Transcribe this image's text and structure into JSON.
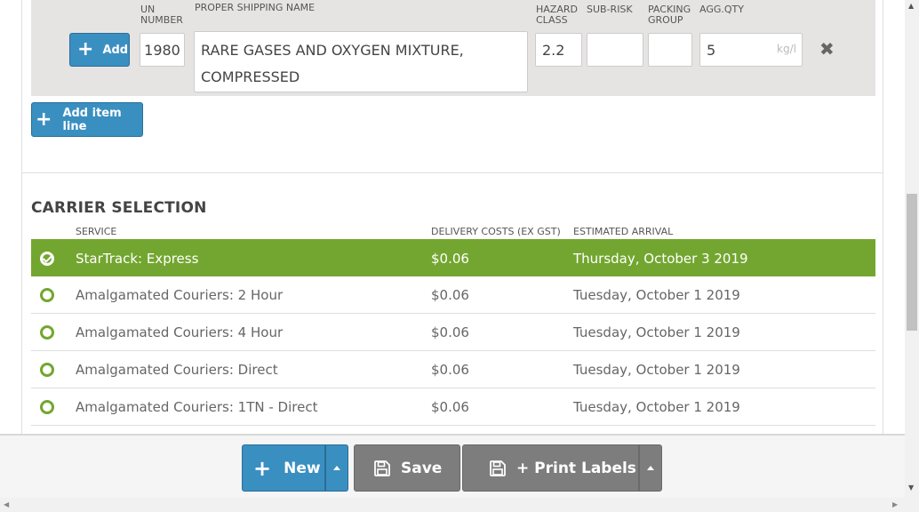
{
  "dg_item": {
    "add_label": "Add",
    "labels": {
      "un_number": "UN NUMBER",
      "proper_shipping_name": "PROPER SHIPPING NAME",
      "hazard_class": "HAZARD CLASS",
      "sub_risk": "SUB-RISK",
      "packing_group": "PACKING GROUP",
      "agg_qty": "AGG.QTY"
    },
    "un_number": "1980",
    "proper_shipping_name": "RARE GASES AND OXYGEN MIXTURE, COMPRESSED",
    "hazard_class": "2.2",
    "sub_risk": "",
    "packing_group": "",
    "agg_qty": "5",
    "agg_qty_unit": "kg/l",
    "remove_glyph": "✖"
  },
  "add_item_line_label": "Add item line",
  "carrier_selection": {
    "title": "CARRIER SELECTION",
    "columns": {
      "service": "SERVICE",
      "cost": "DELIVERY COSTS (EX GST)",
      "eta": "ESTIMATED ARRIVAL"
    },
    "rows": [
      {
        "service": "StarTrack: Express",
        "cost": "$0.06",
        "eta": "Thursday, October 3 2019",
        "selected": true
      },
      {
        "service": "Amalgamated Couriers: 2 Hour",
        "cost": "$0.06",
        "eta": "Tuesday, October 1 2019",
        "selected": false
      },
      {
        "service": "Amalgamated Couriers: 4 Hour",
        "cost": "$0.06",
        "eta": "Tuesday, October 1 2019",
        "selected": false
      },
      {
        "service": "Amalgamated Couriers: Direct",
        "cost": "$0.06",
        "eta": "Tuesday, October 1 2019",
        "selected": false
      },
      {
        "service": "Amalgamated Couriers: 1TN - Direct",
        "cost": "$0.06",
        "eta": "Tuesday, October 1 2019",
        "selected": false
      }
    ]
  },
  "actions": {
    "new_label": "New",
    "save_label": "Save",
    "print_labels_label": "+ Print Labels"
  },
  "colors": {
    "primary_blue": "#3a8fc1",
    "selected_green": "#73a630",
    "neutral_grey": "#7d7d7d"
  },
  "icons": [
    "plus-icon",
    "remove-icon",
    "radio-icon",
    "check-icon",
    "caret-up-icon",
    "floppy-disk-icon"
  ]
}
